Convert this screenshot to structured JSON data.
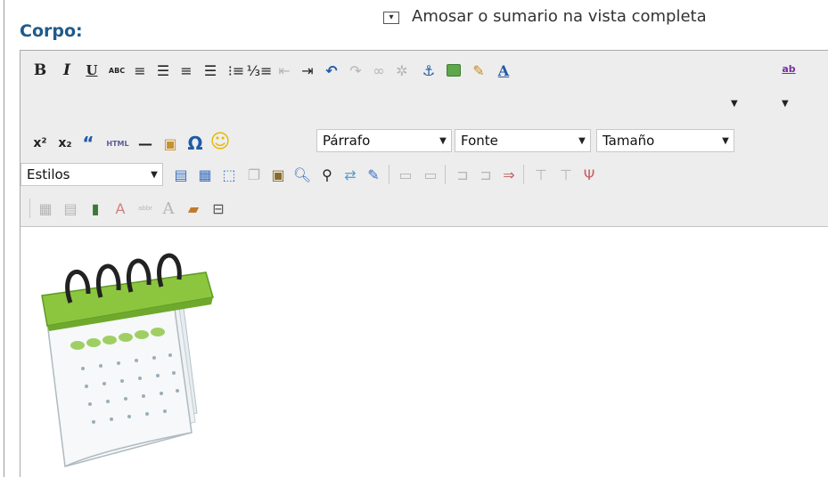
{
  "labels": {
    "corpo": "Corpo:",
    "summary_option": "Amosar o sumario na vista completa"
  },
  "toolbar": {
    "bold": "B",
    "italic": "I",
    "underline": "U",
    "strike": "ABC",
    "html": "HTML",
    "combo_format": "Párrafo",
    "combo_font": "Fonte",
    "combo_size": "Tamaño",
    "combo_styles": "Estilos",
    "text_color_glyph": "A",
    "highlight_glyph": "ab",
    "superscript_glyph": "x²",
    "subscript_glyph": "x₂"
  },
  "colors": {
    "label_blue": "#1f5a8a",
    "toolbar_bg": "#ededed",
    "calendar_green": "#8cc63f"
  },
  "content": {
    "image_icon": "calendar-icon"
  }
}
